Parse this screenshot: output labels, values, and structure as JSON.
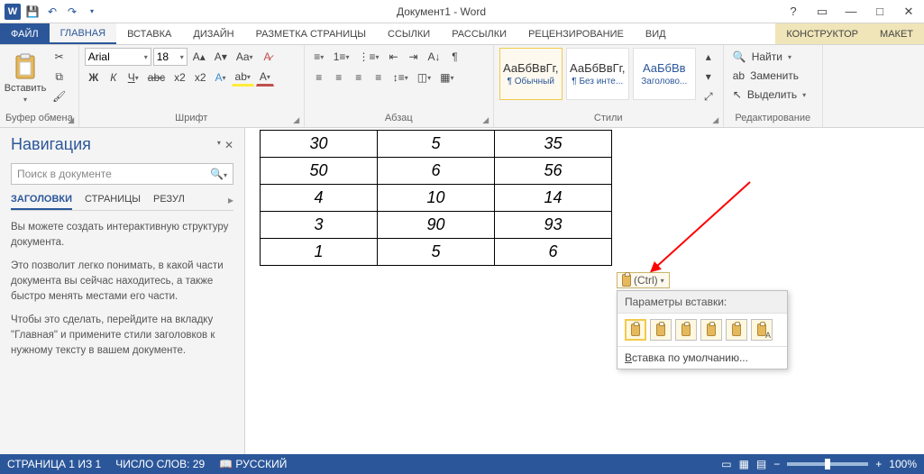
{
  "app": {
    "title": "Документ1 - Word"
  },
  "qat": {
    "save": "💾",
    "undo": "↶",
    "redo": "↷"
  },
  "wincontrols": {
    "help": "?",
    "ribbon_opts": "▭",
    "min": "—",
    "max": "□",
    "close": "✕"
  },
  "tabs": {
    "file": "ФАЙЛ",
    "home": "ГЛАВНАЯ",
    "insert": "ВСТАВКА",
    "design": "ДИЗАЙН",
    "layout": "РАЗМЕТКА СТРАНИЦЫ",
    "refs": "ССЫЛКИ",
    "mail": "РАССЫЛКИ",
    "review": "РЕЦЕНЗИРОВАНИЕ",
    "view": "ВИД",
    "ctx1": "КОНСТРУКТОР",
    "ctx2": "МАКЕТ"
  },
  "ribbon": {
    "clipboard": {
      "paste": "Вставить",
      "label": "Буфер обмена"
    },
    "font": {
      "name": "Arial",
      "size": "18",
      "bold": "Ж",
      "italic": "К",
      "underline": "Ч",
      "label": "Шрифт"
    },
    "paragraph": {
      "label": "Абзац"
    },
    "styles": {
      "label": "Стили",
      "s1_sample": "АаБбВвГг,",
      "s1_name": "¶ Обычный",
      "s2_sample": "АаБбВвГг,",
      "s2_name": "¶ Без инте...",
      "s3_sample": "АаБбВв",
      "s3_name": "Заголово..."
    },
    "editing": {
      "find": "Найти",
      "replace": "Заменить",
      "select": "Выделить",
      "label": "Редактирование"
    }
  },
  "nav": {
    "title": "Навигация",
    "search_placeholder": "Поиск в документе",
    "tab_headings": "ЗАГОЛОВКИ",
    "tab_pages": "СТРАНИЦЫ",
    "tab_results": "РЕЗУЛ",
    "p1": "Вы можете создать интерактивную структуру документа.",
    "p2": "Это позволит легко понимать, в какой части документа вы сейчас находитесь, а также быстро менять местами его части.",
    "p3": "Чтобы это сделать, перейдите на вкладку \"Главная\" и примените стили заголовков к нужному тексту в вашем документе."
  },
  "table": {
    "rows": [
      [
        "30",
        "5",
        "35"
      ],
      [
        "50",
        "6",
        "56"
      ],
      [
        "4",
        "10",
        "14"
      ],
      [
        "3",
        "90",
        "93"
      ],
      [
        "1",
        "5",
        "6"
      ]
    ]
  },
  "paste_tag": {
    "label": "(Ctrl)"
  },
  "paste_popup": {
    "header": "Параметры вставки:",
    "footer_pre": "В",
    "footer_rest": "ставка по умолчанию..."
  },
  "status": {
    "page": "СТРАНИЦА 1 ИЗ 1",
    "words": "ЧИСЛО СЛОВ: 29",
    "lang": "РУССКИЙ",
    "zoom": "100%"
  }
}
